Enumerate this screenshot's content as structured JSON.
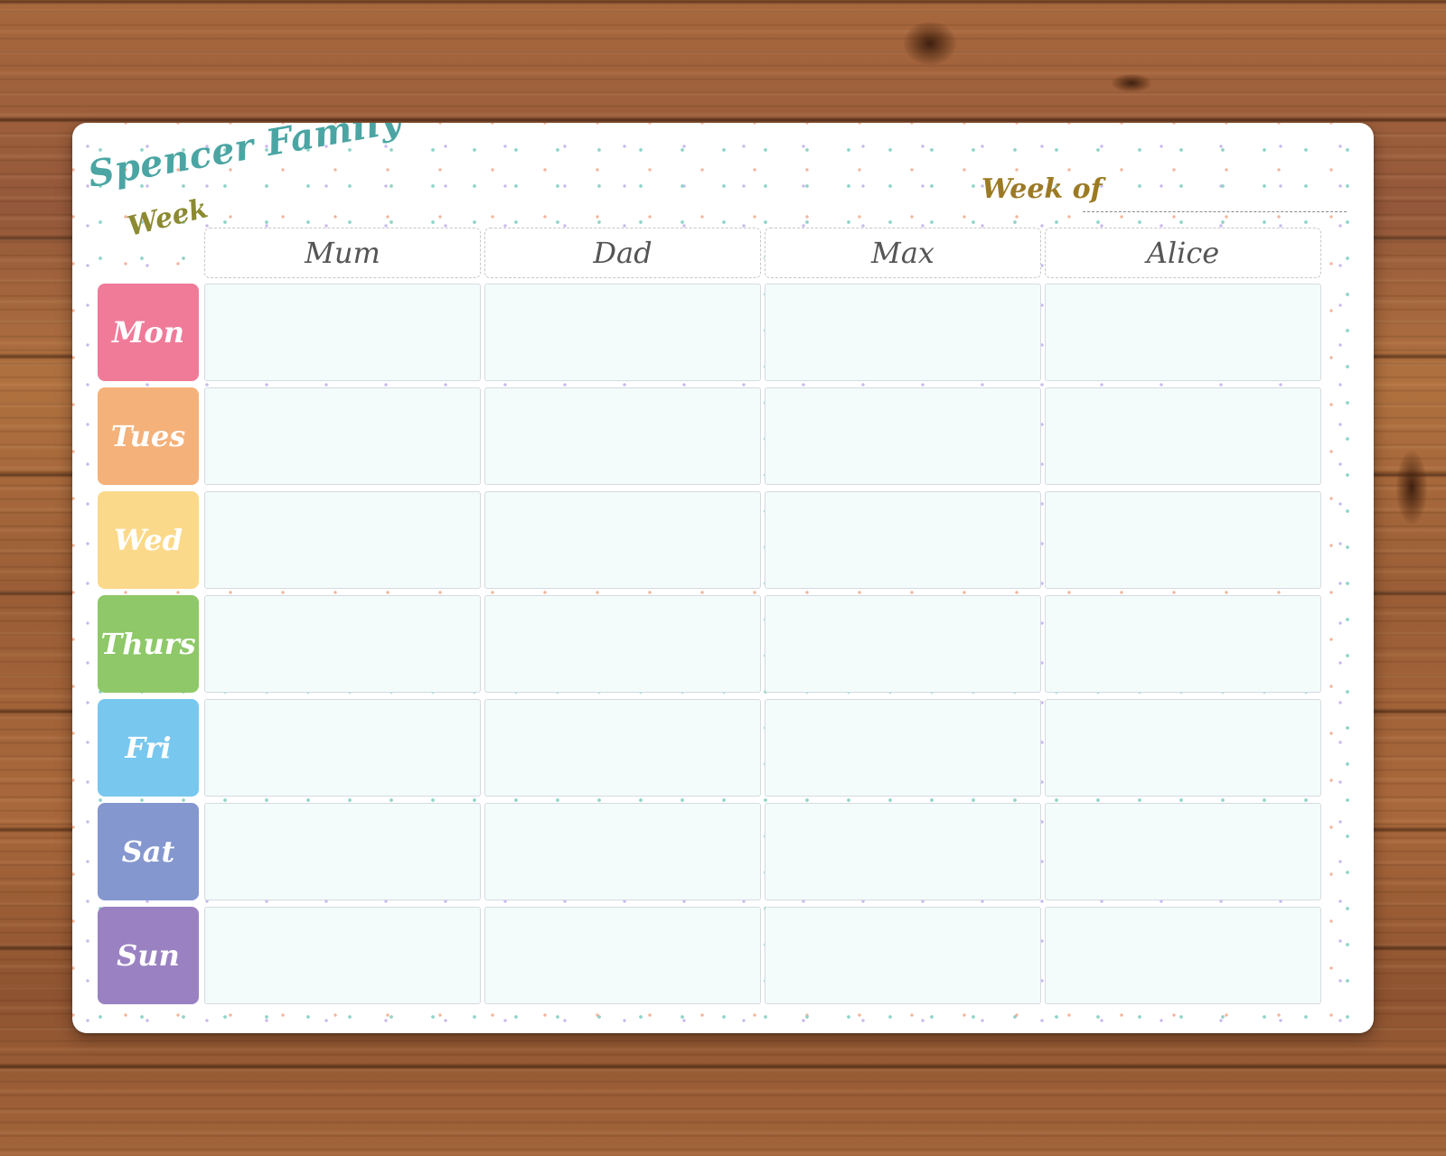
{
  "planner": {
    "title": "Spencer Family",
    "subtitle": "Week",
    "week_of_label": "Week of",
    "week_of_value": ""
  },
  "members": [
    "Mum",
    "Dad",
    "Max",
    "Alice"
  ],
  "days": [
    {
      "label": "Mon",
      "color": "#f07b99"
    },
    {
      "label": "Tues",
      "color": "#f4b17a"
    },
    {
      "label": "Wed",
      "color": "#fbd98a"
    },
    {
      "label": "Thurs",
      "color": "#8ec868"
    },
    {
      "label": "Fri",
      "color": "#78c7ef"
    },
    {
      "label": "Sat",
      "color": "#8597cf"
    },
    {
      "label": "Sun",
      "color": "#9a82c2"
    }
  ],
  "colors": {
    "title": "#4aa5a3",
    "subtitle": "#8c8a32",
    "week_of": "#9c7a24",
    "cell_fill": "#f3fcfb",
    "header_text": "#555555"
  }
}
